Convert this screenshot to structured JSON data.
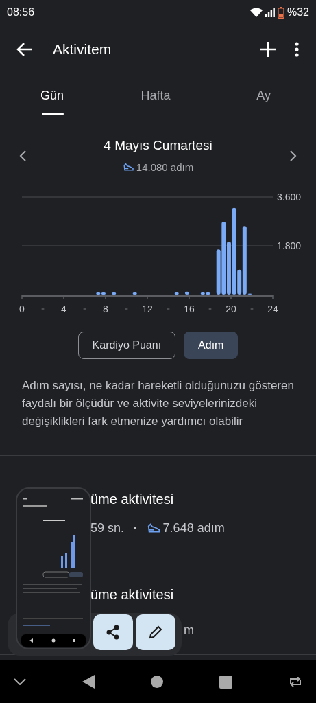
{
  "status_bar": {
    "time": "08:56",
    "battery": "%32"
  },
  "toolbar": {
    "title": "Aktivitem"
  },
  "tabs": [
    {
      "label": "Gün",
      "selected": true
    },
    {
      "label": "Hafta",
      "selected": false
    },
    {
      "label": "Ay",
      "selected": false
    }
  ],
  "date": {
    "title": "4 Mayıs Cumartesi",
    "steps": "14.080 adım"
  },
  "chart_data": {
    "type": "bar",
    "x": [
      7.3,
      7.8,
      8.8,
      10.8,
      14.8,
      15.8,
      17.3,
      17.8,
      18.8,
      19.3,
      19.8,
      20.3,
      20.8,
      21.3,
      21.8
    ],
    "values": [
      80,
      80,
      80,
      80,
      80,
      110,
      80,
      80,
      1670,
      2690,
      1950,
      3200,
      920,
      2530,
      40
    ],
    "xlim": [
      0,
      24
    ],
    "ylim": [
      0,
      3600
    ],
    "xticks": [
      0,
      4,
      8,
      12,
      16,
      20,
      24
    ],
    "yticks": [
      {
        "value": 1800,
        "label": "1.800"
      },
      {
        "value": 3600,
        "label": "3.600"
      }
    ]
  },
  "metric_toggle": [
    {
      "label": "Kardiyo Puanı",
      "selected": false
    },
    {
      "label": "Adım",
      "selected": true
    }
  ],
  "description": "Adım sayısı, ne kadar hareketli olduğunuzu gösteren faydalı bir ölçüdür ve aktivite seviyelerinizdeki değişiklikleri fark etmenize yardımcı olabilir",
  "activities": [
    {
      "title": "üme aktivitesi",
      "duration": "59 sn.",
      "separator": "•",
      "steps": "7.648 adım"
    },
    {
      "title": "üme aktivitesi",
      "tail": "m"
    }
  ]
}
